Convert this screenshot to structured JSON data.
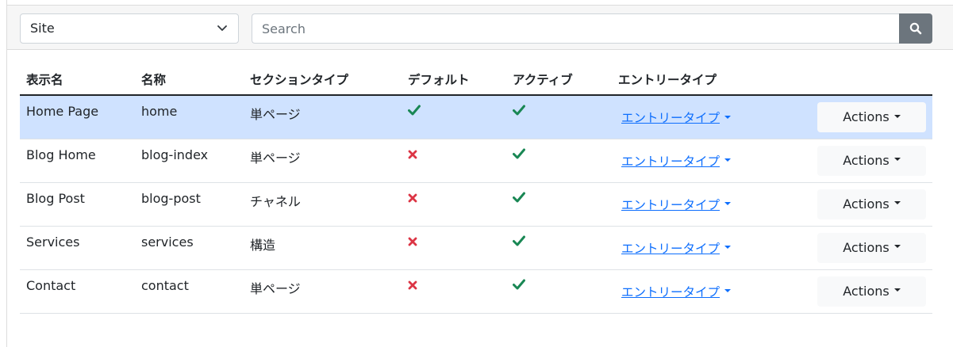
{
  "toolbar": {
    "site_select_value": "Site",
    "search_placeholder": "Search"
  },
  "table": {
    "headers": [
      "表示名",
      "名称",
      "セクションタイプ",
      "デフォルト",
      "アクティブ",
      "エントリータイプ"
    ],
    "rows": [
      {
        "display_name": "Home Page",
        "handle": "home",
        "section_type": "単ページ",
        "default": true,
        "active": true,
        "entry_types": "エントリータイプ",
        "actions": "Actions"
      },
      {
        "display_name": "Blog Home",
        "handle": "blog-index",
        "section_type": "単ページ",
        "default": false,
        "active": true,
        "entry_types": "エントリータイプ",
        "actions": "Actions"
      },
      {
        "display_name": "Blog Post",
        "handle": "blog-post",
        "section_type": "チャネル",
        "default": false,
        "active": true,
        "entry_types": "エントリータイプ",
        "actions": "Actions"
      },
      {
        "display_name": "Services",
        "handle": "services",
        "section_type": "構造",
        "default": false,
        "active": true,
        "entry_types": "エントリータイプ",
        "actions": "Actions"
      },
      {
        "display_name": "Contact",
        "handle": "contact",
        "section_type": "単ページ",
        "default": false,
        "active": true,
        "entry_types": "エントリータイプ",
        "actions": "Actions"
      }
    ]
  },
  "colors": {
    "check": "#198754",
    "cross": "#dc3545",
    "selected_row": "#cfe2ff",
    "link": "#0d6efd"
  },
  "icons": {
    "check": "check-icon",
    "cross": "x-icon",
    "search": "search-icon",
    "select": "chevron-down-icon"
  }
}
